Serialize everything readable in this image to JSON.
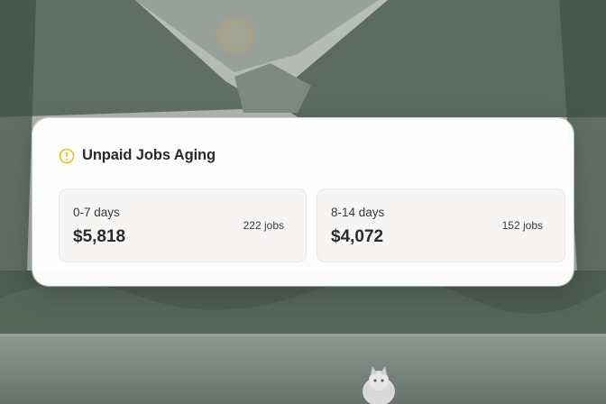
{
  "widget": {
    "title": "Unpaid Jobs Aging",
    "icon": "alert-circle-icon",
    "accent_color": "#f2b91e",
    "buckets": [
      {
        "range": "0-7 days",
        "amount": "$5,818",
        "count": "222 jobs"
      },
      {
        "range": "8-14 days",
        "amount": "$4,072",
        "count": "152 jobs"
      }
    ]
  },
  "background": {
    "description_icon": "landscape-background",
    "sky_color": "#aeb6ae",
    "mountain_color": "#6f7f76",
    "forest_color": "#49594f",
    "water_color": "#7d8a84",
    "sun_color": "#f2c98e"
  }
}
